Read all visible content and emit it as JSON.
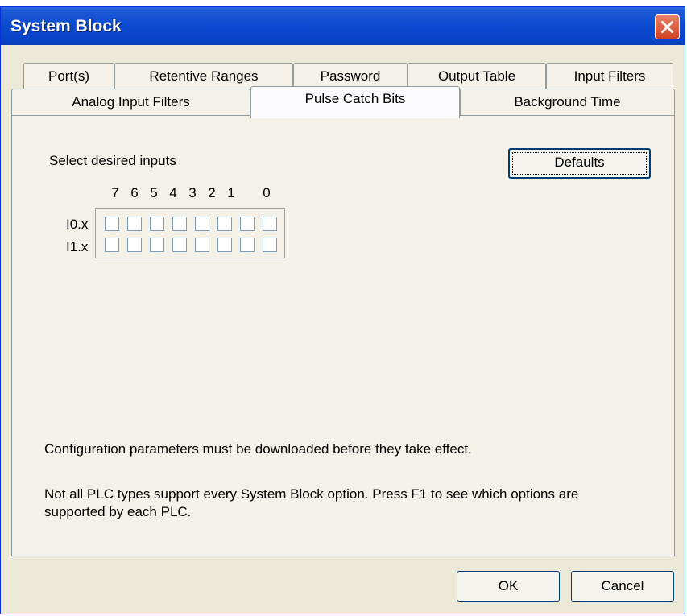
{
  "window": {
    "title": "System Block"
  },
  "tabs": {
    "row1": [
      "Port(s)",
      "Retentive Ranges",
      "Password",
      "Output Table",
      "Input Filters"
    ],
    "row2": [
      "Analog Input Filters",
      "Pulse Catch Bits",
      "Background Time"
    ],
    "active": "Pulse Catch Bits"
  },
  "panel": {
    "instruction": "Select desired inputs",
    "defaults_label": "Defaults",
    "bit_headers": [
      "7",
      "6",
      "5",
      "4",
      "3",
      "2",
      "1",
      "0"
    ],
    "rows": [
      {
        "label": "I0.x",
        "checked": [
          false,
          false,
          false,
          false,
          false,
          false,
          false,
          false
        ]
      },
      {
        "label": "I1.x",
        "checked": [
          false,
          false,
          false,
          false,
          false,
          false,
          false,
          false
        ]
      }
    ],
    "note1": "Configuration parameters must be downloaded before they take effect.",
    "note2_line1": "Not all PLC types support every System Block option.  Press F1 to see which options are",
    "note2_line2": "supported by each PLC."
  },
  "buttons": {
    "ok": "OK",
    "cancel": "Cancel"
  },
  "colors": {
    "titlebar": "#0a4ad0",
    "close": "#d3431f",
    "face": "#ece9d8"
  }
}
